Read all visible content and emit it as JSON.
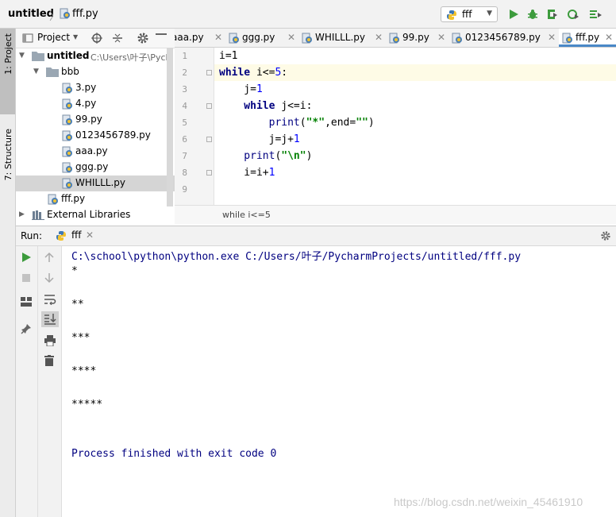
{
  "navbar": {
    "project": "untitled",
    "separator": "〉",
    "file": "fff.py",
    "run_config": "fff",
    "colors": {
      "run": "#3c9b3c",
      "debug": "#3c9b3c"
    }
  },
  "left_strip": {
    "project_label": "1: Project",
    "structure_label": "7: Structure"
  },
  "project_panel": {
    "title": "Project",
    "root": {
      "name": "untitled",
      "path": "C:\\Users\\叶子\\Pych"
    },
    "folder": "bbb",
    "files": [
      "3.py",
      "4.py",
      "99.py",
      "0123456789.py",
      "aaa.py",
      "ggg.py",
      "WHILLL.py"
    ],
    "root_file": "fff.py",
    "external": "External Libraries"
  },
  "editor": {
    "tabs": [
      {
        "label": "aaa.py"
      },
      {
        "label": "ggg.py"
      },
      {
        "label": "WHILLL.py"
      },
      {
        "label": "99.py"
      },
      {
        "label": "0123456789.py"
      },
      {
        "label": "fff.py",
        "active": true
      }
    ],
    "line_numbers": [
      "1",
      "2",
      "3",
      "4",
      "5",
      "6",
      "7",
      "8",
      "9"
    ],
    "code": {
      "l1": "i=1",
      "l2_kw": "while",
      "l2_rest": " i<=",
      "l2_num": "5",
      "l2_end": ":",
      "l3_a": "    j=",
      "l3_num": "1",
      "l4_kw": "    while",
      "l4_rest": " j<=i:",
      "l5_fn": "        print",
      "l5_a": "(",
      "l5_s1": "\"*\"",
      "l5_b": ",end=",
      "l5_s2": "\"\"",
      "l5_c": ")",
      "l6_a": "        j=j+",
      "l6_num": "1",
      "l7_fn": "    print",
      "l7_a": "(",
      "l7_s": "\"\\n\"",
      "l7_c": ")",
      "l8_a": "    i=i+",
      "l8_num": "1"
    },
    "breadcrumb": "while i<=5"
  },
  "run_panel": {
    "label": "Run:",
    "tab": "fff",
    "console": {
      "command": "C:\\school\\python\\python.exe C:/Users/叶子/PycharmProjects/untitled/fff.py",
      "out1": "*",
      "out2": "**",
      "out3": "***",
      "out4": "****",
      "out5": "*****",
      "exit": "Process finished with exit code 0"
    }
  },
  "watermark": "https://blog.csdn.net/weixin_45461910"
}
